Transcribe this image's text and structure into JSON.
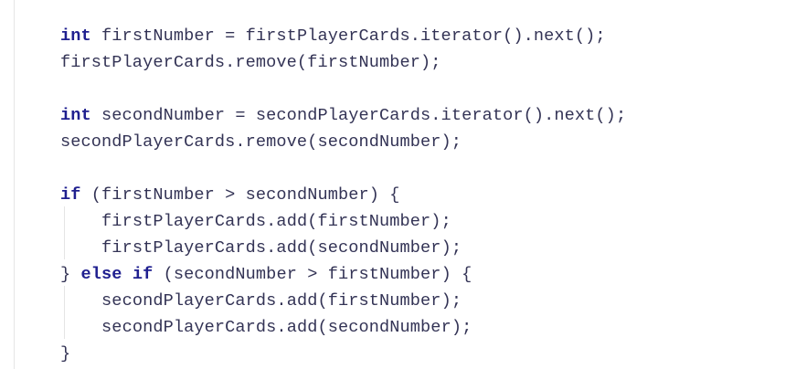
{
  "code": {
    "lines": [
      {
        "indent": "",
        "kw": "int",
        "rest": " firstNumber = firstPlayerCards.iterator().next();",
        "pre": ""
      },
      {
        "indent": "",
        "kw": "",
        "rest": "firstPlayerCards.remove(firstNumber);",
        "pre": ""
      },
      {
        "indent": "",
        "kw": "",
        "rest": "",
        "pre": ""
      },
      {
        "indent": "",
        "kw": "int",
        "rest": " secondNumber = secondPlayerCards.iterator().next();",
        "pre": ""
      },
      {
        "indent": "",
        "kw": "",
        "rest": "secondPlayerCards.remove(secondNumber);",
        "pre": ""
      },
      {
        "indent": "",
        "kw": "",
        "rest": "",
        "pre": ""
      },
      {
        "indent": "",
        "kw": "if",
        "rest": " (firstNumber > secondNumber) {",
        "pre": ""
      },
      {
        "indent": "    ",
        "kw": "",
        "rest": "firstPlayerCards.add(firstNumber);",
        "pre": ""
      },
      {
        "indent": "    ",
        "kw": "",
        "rest": "firstPlayerCards.add(secondNumber);",
        "pre": ""
      },
      {
        "indent": "",
        "kw": "else if",
        "rest": " (secondNumber > firstNumber) {",
        "pre": "} "
      },
      {
        "indent": "    ",
        "kw": "",
        "rest": "secondPlayerCards.add(firstNumber);",
        "pre": ""
      },
      {
        "indent": "    ",
        "kw": "",
        "rest": "secondPlayerCards.add(secondNumber);",
        "pre": ""
      },
      {
        "indent": "",
        "kw": "",
        "rest": "}",
        "pre": ""
      }
    ]
  }
}
